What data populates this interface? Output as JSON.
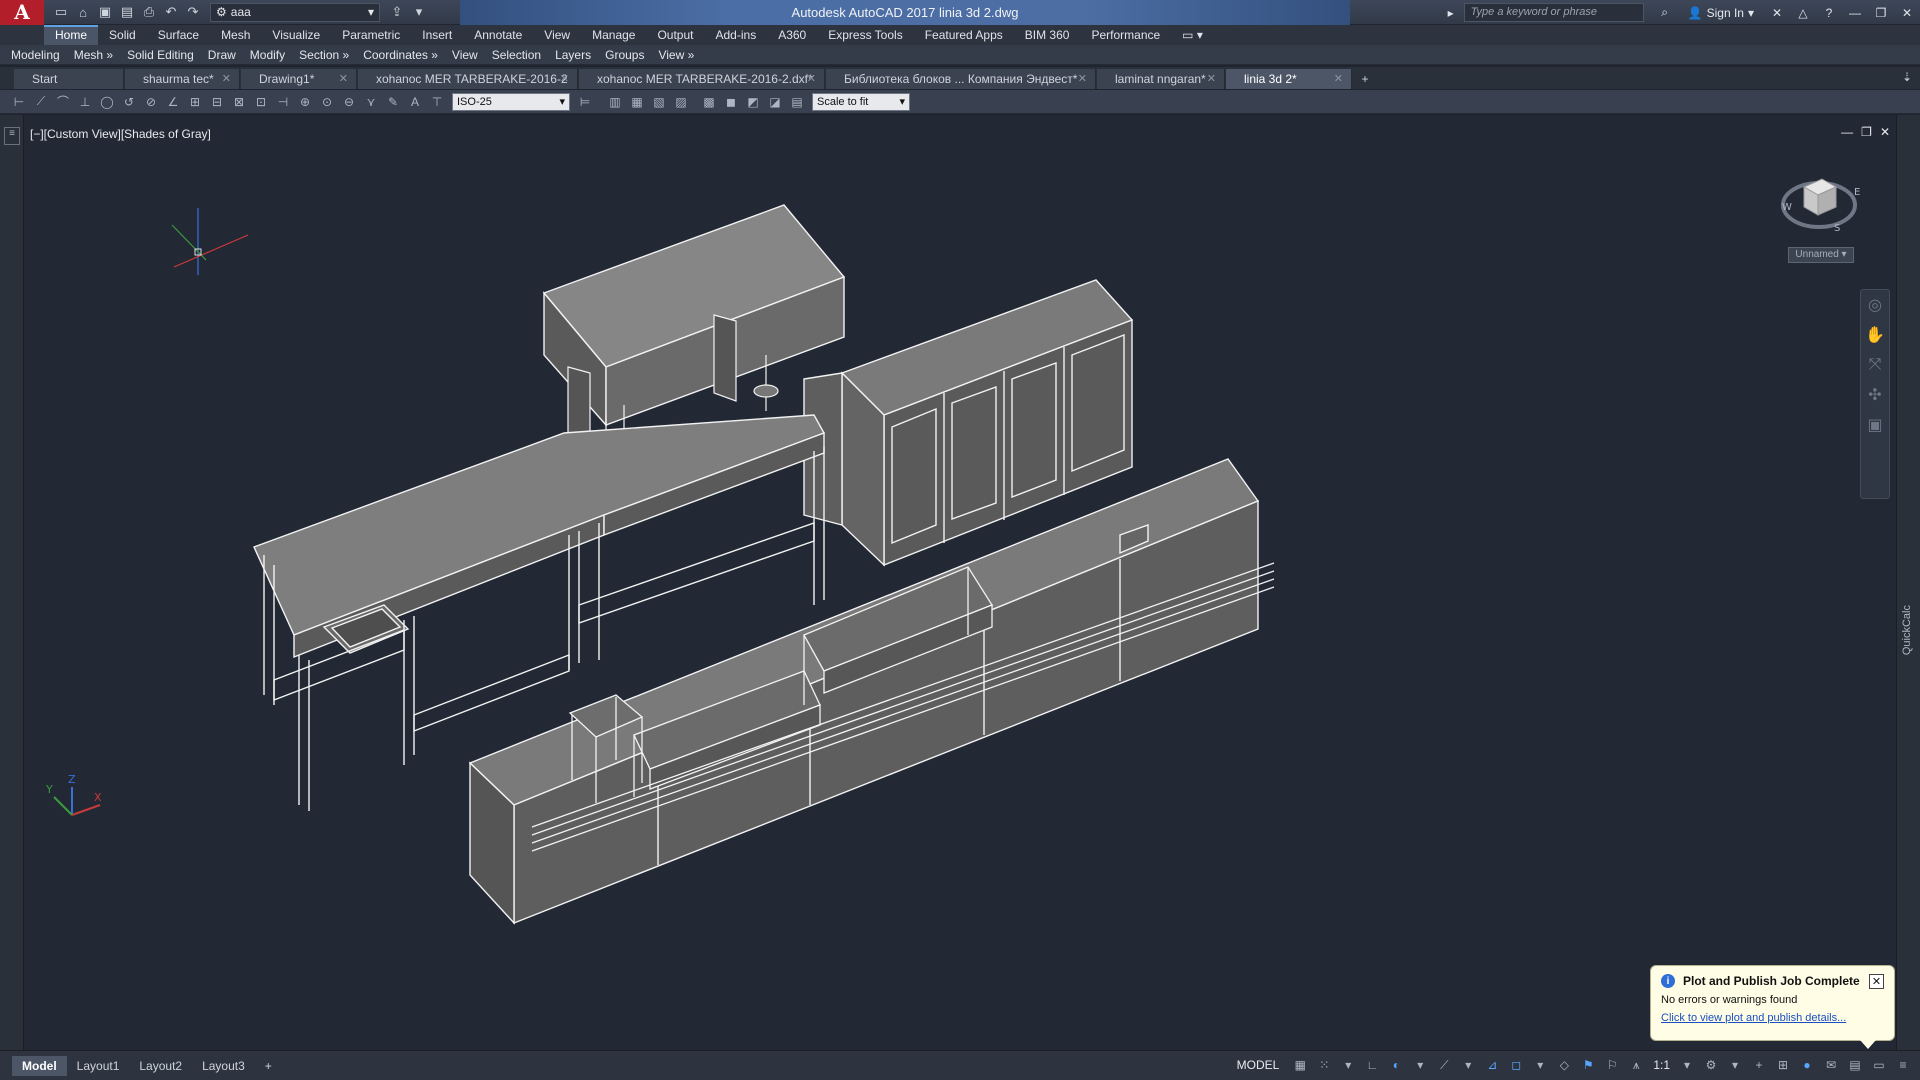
{
  "titlebar": {
    "logo": "A",
    "workspace": "aaa",
    "title": "Autodesk AutoCAD 2017    linia 3d 2.dwg",
    "search_placeholder": "Type a keyword or phrase",
    "sign_in": "Sign In"
  },
  "ribbon_tabs": [
    "Home",
    "Solid",
    "Surface",
    "Mesh",
    "Visualize",
    "Parametric",
    "Insert",
    "Annotate",
    "View",
    "Manage",
    "Output",
    "Add-ins",
    "A360",
    "Express Tools",
    "Featured Apps",
    "BIM 360",
    "Performance"
  ],
  "menu_bar": [
    "Modeling",
    "Mesh »",
    "Solid Editing",
    "Draw",
    "Modify",
    "Section »",
    "Coordinates »",
    "View",
    "Selection",
    "Layers",
    "Groups",
    "View »"
  ],
  "file_tabs": [
    {
      "label": "Start"
    },
    {
      "label": "shaurma tec*"
    },
    {
      "label": "Drawing1*"
    },
    {
      "label": "xohanoc MER TARBERAKE-2016-2"
    },
    {
      "label": "xohanoc MER TARBERAKE-2016-2.dxf*"
    },
    {
      "label": "Библиотека блоков ... Компания Эндвест*"
    },
    {
      "label": "laminat nngaran*"
    },
    {
      "label": "linia 3d 2*"
    }
  ],
  "toolbar": {
    "dimstyle": "ISO-25",
    "scale": "Scale to fit"
  },
  "viewport": {
    "label": "[−][Custom View][Shades of Gray]",
    "viewcube_label": "Unnamed",
    "compass": {
      "w": "W",
      "s": "S",
      "e": "E"
    }
  },
  "quickcalc": "QuickCalc",
  "notification": {
    "title": "Plot and Publish Job Complete",
    "body": "No errors or warnings found",
    "link": "Click to view plot and publish details..."
  },
  "layout_tabs": [
    "Model",
    "Layout1",
    "Layout2",
    "Layout3"
  ],
  "status": {
    "model": "MODEL",
    "scale": "1:1"
  },
  "ucs": {
    "x": "X",
    "y": "Y",
    "z": "Z"
  }
}
